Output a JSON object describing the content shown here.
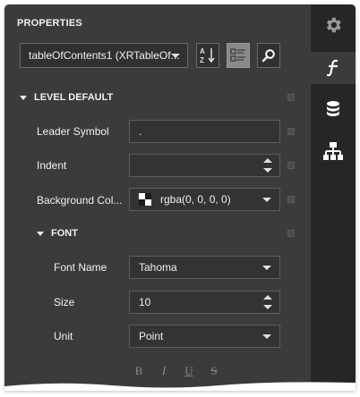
{
  "panel": {
    "title": "PROPERTIES",
    "component_selector": {
      "value": "tableOfContents1 (XRTableOf..."
    }
  },
  "toolbar": {
    "sort_icon": "sort-az-icon",
    "categories_icon": "categories-list-icon",
    "search_icon": "search-icon"
  },
  "sidebar": {
    "settings_icon": "gear-icon",
    "tabs": [
      {
        "icon": "function-icon",
        "active": true
      },
      {
        "icon": "database-icon",
        "active": false
      },
      {
        "icon": "hierarchy-icon",
        "active": false
      }
    ]
  },
  "level_default": {
    "header": "LEVEL DEFAULT",
    "leader_symbol": {
      "label": "Leader Symbol",
      "value": "."
    },
    "indent": {
      "label": "Indent",
      "value": ""
    },
    "background_color": {
      "label": "Background Col...",
      "value": "rgba(0, 0, 0, 0)"
    }
  },
  "font": {
    "header": "FONT",
    "font_name": {
      "label": "Font Name",
      "value": "Tahoma"
    },
    "size": {
      "label": "Size",
      "value": "10"
    },
    "unit": {
      "label": "Unit",
      "value": "Point"
    },
    "style_buttons": [
      "B",
      "I",
      "U",
      "S"
    ]
  },
  "colors": {
    "panel_bg": "#3b3b3b",
    "sidebar_bg": "#262626",
    "active_toggle": "#8a8a8a"
  }
}
